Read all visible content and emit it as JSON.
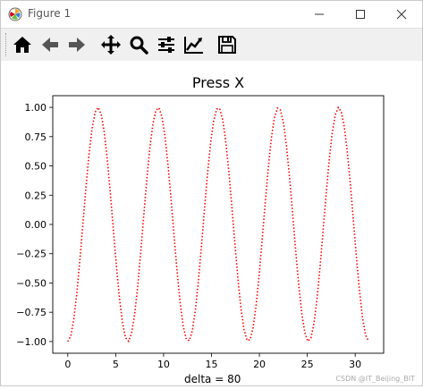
{
  "window": {
    "title": "Figure 1"
  },
  "toolbar": {
    "buttons": [
      {
        "name": "home-button",
        "icon": "home-icon"
      },
      {
        "name": "back-button",
        "icon": "arrow-left-icon"
      },
      {
        "name": "forward-button",
        "icon": "arrow-right-icon"
      },
      {
        "name": "pan-button",
        "icon": "move-icon"
      },
      {
        "name": "zoom-button",
        "icon": "magnifier-icon"
      },
      {
        "name": "configure-subplots-button",
        "icon": "sliders-icon"
      },
      {
        "name": "edit-axis-button",
        "icon": "line-chart-icon"
      },
      {
        "name": "save-button",
        "icon": "floppy-disk-icon"
      }
    ]
  },
  "figure": {
    "footer_text": "delta = 80",
    "watermark": "CSDN @IT_Beijing_BIT"
  },
  "chart_data": {
    "type": "line",
    "title": "Press X",
    "xlabel": "",
    "ylabel": "",
    "xlim": [
      -1.57,
      32.97
    ],
    "ylim": [
      -1.1,
      1.1
    ],
    "xticks": [
      0,
      5,
      10,
      15,
      20,
      25,
      30
    ],
    "yticks": [
      -1.0,
      -0.75,
      -0.5,
      -0.25,
      0.0,
      0.25,
      0.5,
      0.75,
      1.0
    ],
    "xtick_labels": [
      "0",
      "5",
      "10",
      "15",
      "20",
      "25",
      "30"
    ],
    "ytick_labels": [
      "−1.00",
      "−0.75",
      "−0.50",
      "−0.25",
      "0.00",
      "0.25",
      "0.50",
      "0.75",
      "1.00"
    ],
    "grid": false,
    "series": [
      {
        "style": "dotted",
        "color": "#ff0000",
        "function": "-cos(x)",
        "x_start": 0,
        "x_end": 31.4,
        "num_points": 100
      }
    ]
  }
}
